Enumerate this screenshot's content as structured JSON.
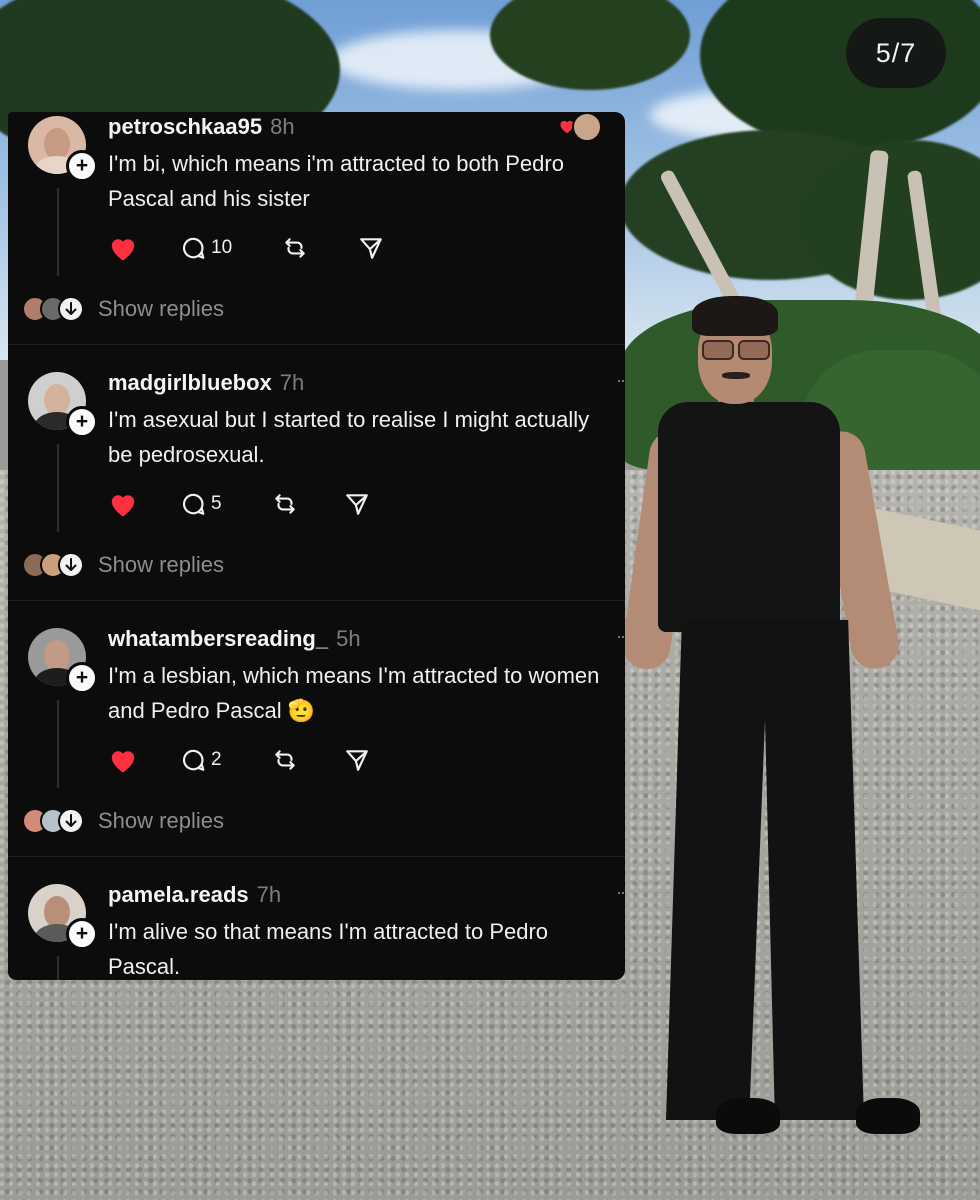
{
  "slide_counter": "5/7",
  "posts": [
    {
      "username": "petroschkaa95",
      "time": "8h",
      "text": "I'm bi, which means i'm attracted to both Pedro Pascal and his sister",
      "liked": true,
      "replies": "10",
      "show_replies": "Show replies"
    },
    {
      "username": "madgirlbluebox",
      "time": "7h",
      "text": "I'm asexual but I started to realise I might actually be pedrosexual.",
      "liked": true,
      "replies": "5",
      "show_replies": "Show replies"
    },
    {
      "username": "whatambersreading_",
      "time": "5h",
      "text": "I'm a lesbian, which means I'm attracted to women and Pedro Pascal 🫡",
      "liked": true,
      "replies": "2",
      "show_replies": "Show replies"
    },
    {
      "username": "pamela.reads",
      "time": "7h",
      "text": "I'm alive so that means I'm attracted to Pedro Pascal."
    }
  ],
  "colors": {
    "panel_bg": "#0c0c0c",
    "heart": "#ff3040",
    "muted_text": "#8d8d8d"
  },
  "icons": [
    "heart-icon",
    "comment-icon",
    "repost-icon",
    "share-icon",
    "plus-icon",
    "arrow-down-icon"
  ]
}
